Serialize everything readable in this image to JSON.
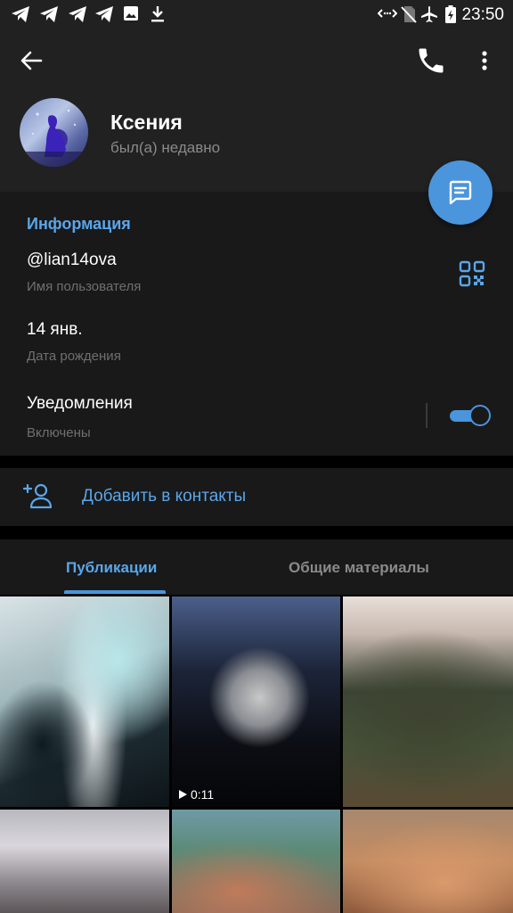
{
  "status_bar": {
    "time": "23:50",
    "left_icons": [
      "telegram-icon",
      "telegram-icon",
      "telegram-icon",
      "telegram-icon",
      "image-icon",
      "download-icon"
    ],
    "right_icons": [
      "data-icon",
      "no-sim-icon",
      "airplane-icon",
      "battery-charging-icon"
    ]
  },
  "header": {
    "icons": [
      "back-arrow-icon",
      "phone-icon",
      "more-vertical-icon"
    ]
  },
  "profile": {
    "name": "Ксения",
    "status": "был(а) недавно"
  },
  "info": {
    "title": "Информация",
    "username": "@lian14ova",
    "username_label": "Имя пользователя",
    "birthday": "14 янв.",
    "birthday_label": "Дата рождения",
    "notifications": "Уведомления",
    "notifications_state": "Включены",
    "notifications_enabled": true
  },
  "add_contact": {
    "label": "Добавить в контакты"
  },
  "tabs": {
    "items": [
      {
        "label": "Публикации",
        "active": true
      },
      {
        "label": "Общие материалы",
        "active": false
      }
    ]
  },
  "media": {
    "video_duration": "0:11"
  },
  "colors": {
    "accent": "#4a95dc",
    "accent_text": "#5aa6ea",
    "background": "#191919",
    "header_background": "#212121",
    "secondary_text": "#8a8a8a"
  }
}
